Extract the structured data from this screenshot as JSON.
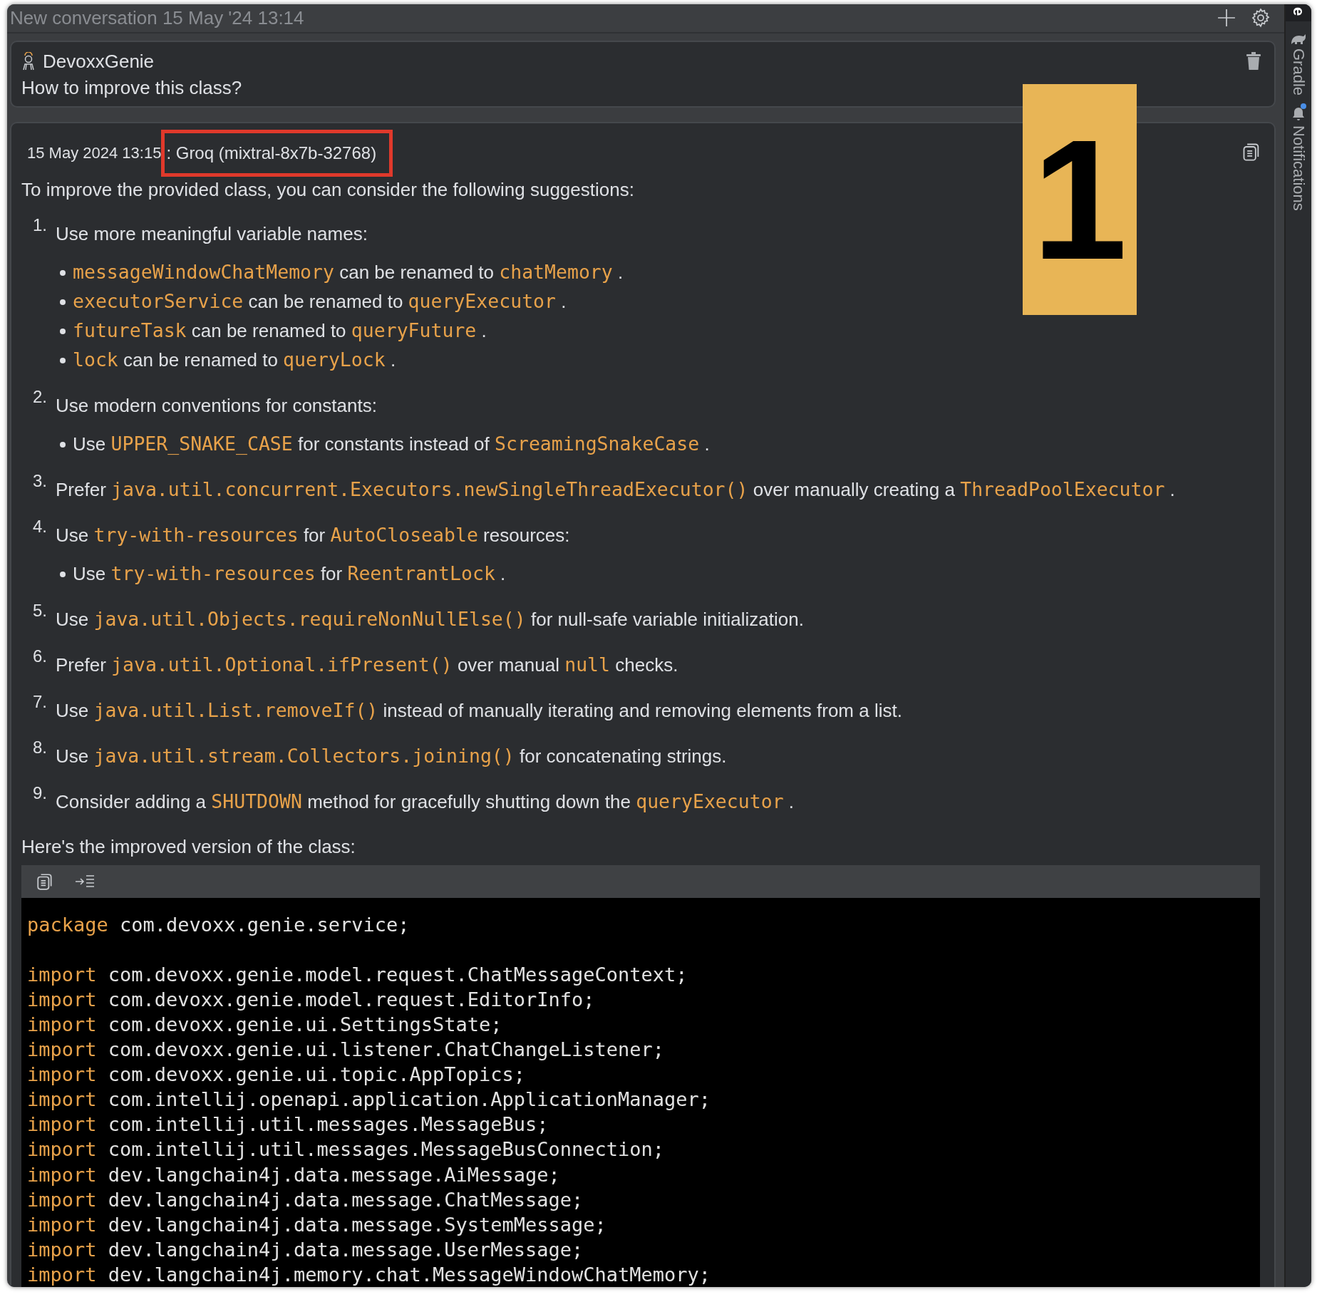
{
  "window": {
    "title": "New conversation 15 May '24 13:14"
  },
  "sidebar": {
    "items": [
      {
        "label": "e",
        "kind": "active"
      },
      {
        "label": "Gradle",
        "kind": "gradle",
        "badge": false
      },
      {
        "label": "Notifications",
        "kind": "notifications",
        "badge": true
      }
    ]
  },
  "question": {
    "author": "DevoxxGenie",
    "text": "How to improve this class?"
  },
  "answer": {
    "timestamp": "15 May 2024 13:15",
    "model": ": Groq (mixtral-8x7b-32768)",
    "model_highlighted": true,
    "intro": "To improve the provided class, you can consider the following suggestions:",
    "items": [
      {
        "number": "1.",
        "parts": [
          {
            "kind": "text",
            "text": "Use more meaningful variable names:"
          }
        ],
        "bullets": [
          [
            {
              "kind": "code",
              "text": "messageWindowChatMemory"
            },
            {
              "kind": "text",
              "text": " can be renamed to "
            },
            {
              "kind": "code",
              "text": "chatMemory"
            },
            {
              "kind": "text",
              "text": " ."
            }
          ],
          [
            {
              "kind": "code",
              "text": "executorService"
            },
            {
              "kind": "text",
              "text": " can be renamed to "
            },
            {
              "kind": "code",
              "text": "queryExecutor"
            },
            {
              "kind": "text",
              "text": " ."
            }
          ],
          [
            {
              "kind": "code",
              "text": "futureTask"
            },
            {
              "kind": "text",
              "text": " can be renamed to "
            },
            {
              "kind": "code",
              "text": "queryFuture"
            },
            {
              "kind": "text",
              "text": " ."
            }
          ],
          [
            {
              "kind": "code",
              "text": "lock"
            },
            {
              "kind": "text",
              "text": " can be renamed to "
            },
            {
              "kind": "code",
              "text": "queryLock"
            },
            {
              "kind": "text",
              "text": " ."
            }
          ]
        ]
      },
      {
        "number": "2.",
        "parts": [
          {
            "kind": "text",
            "text": "Use modern conventions for constants:"
          }
        ],
        "bullets": [
          [
            {
              "kind": "text",
              "text": "Use "
            },
            {
              "kind": "code",
              "text": "UPPER_SNAKE_CASE"
            },
            {
              "kind": "text",
              "text": " for constants instead of "
            },
            {
              "kind": "code",
              "text": "ScreamingSnakeCase"
            },
            {
              "kind": "text",
              "text": " ."
            }
          ]
        ]
      },
      {
        "number": "3.",
        "parts": [
          {
            "kind": "text",
            "text": "Prefer "
          },
          {
            "kind": "code",
            "text": "java.util.concurrent.Executors.newSingleThreadExecutor()"
          },
          {
            "kind": "text",
            "text": " over manually creating a "
          },
          {
            "kind": "code",
            "text": "ThreadPoolExecutor"
          },
          {
            "kind": "text",
            "text": " ."
          }
        ]
      },
      {
        "number": "4.",
        "parts": [
          {
            "kind": "text",
            "text": "Use "
          },
          {
            "kind": "code",
            "text": "try-with-resources"
          },
          {
            "kind": "text",
            "text": " for "
          },
          {
            "kind": "code",
            "text": "AutoCloseable"
          },
          {
            "kind": "text",
            "text": " resources:"
          }
        ],
        "bullets": [
          [
            {
              "kind": "text",
              "text": "Use "
            },
            {
              "kind": "code",
              "text": "try-with-resources"
            },
            {
              "kind": "text",
              "text": " for "
            },
            {
              "kind": "code",
              "text": "ReentrantLock"
            },
            {
              "kind": "text",
              "text": " ."
            }
          ]
        ]
      },
      {
        "number": "5.",
        "parts": [
          {
            "kind": "text",
            "text": "Use "
          },
          {
            "kind": "code",
            "text": "java.util.Objects.requireNonNullElse()"
          },
          {
            "kind": "text",
            "text": " for null-safe variable initialization."
          }
        ]
      },
      {
        "number": "6.",
        "parts": [
          {
            "kind": "text",
            "text": "Prefer "
          },
          {
            "kind": "code",
            "text": "java.util.Optional.ifPresent()"
          },
          {
            "kind": "text",
            "text": " over manual "
          },
          {
            "kind": "code",
            "text": "null"
          },
          {
            "kind": "text",
            "text": " checks."
          }
        ]
      },
      {
        "number": "7.",
        "parts": [
          {
            "kind": "text",
            "text": "Use "
          },
          {
            "kind": "code",
            "text": "java.util.List.removeIf()"
          },
          {
            "kind": "text",
            "text": " instead of manually iterating and removing elements from a list."
          }
        ]
      },
      {
        "number": "8.",
        "parts": [
          {
            "kind": "text",
            "text": "Use "
          },
          {
            "kind": "code",
            "text": "java.util.stream.Collectors.joining()"
          },
          {
            "kind": "text",
            "text": " for concatenating strings."
          }
        ]
      },
      {
        "number": "9.",
        "parts": [
          {
            "kind": "text",
            "text": "Consider adding a "
          },
          {
            "kind": "code",
            "text": "SHUTDOWN"
          },
          {
            "kind": "text",
            "text": " method for gracefully shutting down the "
          },
          {
            "kind": "code",
            "text": "queryExecutor"
          },
          {
            "kind": "text",
            "text": " ."
          }
        ]
      }
    ],
    "outro": "Here's the improved version of the class:",
    "code_lines": [
      {
        "kind": "line",
        "keyword": "package",
        "text": " com.devoxx.genie.service;"
      },
      {
        "kind": "blank"
      },
      {
        "kind": "line",
        "keyword": "import",
        "text": " com.devoxx.genie.model.request.ChatMessageContext;"
      },
      {
        "kind": "line",
        "keyword": "import",
        "text": " com.devoxx.genie.model.request.EditorInfo;"
      },
      {
        "kind": "line",
        "keyword": "import",
        "text": " com.devoxx.genie.ui.SettingsState;"
      },
      {
        "kind": "line",
        "keyword": "import",
        "text": " com.devoxx.genie.ui.listener.ChatChangeListener;"
      },
      {
        "kind": "line",
        "keyword": "import",
        "text": " com.devoxx.genie.ui.topic.AppTopics;"
      },
      {
        "kind": "line",
        "keyword": "import",
        "text": " com.intellij.openapi.application.ApplicationManager;"
      },
      {
        "kind": "line",
        "keyword": "import",
        "text": " com.intellij.util.messages.MessageBus;"
      },
      {
        "kind": "line",
        "keyword": "import",
        "text": " com.intellij.util.messages.MessageBusConnection;"
      },
      {
        "kind": "line",
        "keyword": "import",
        "text": " dev.langchain4j.data.message.AiMessage;"
      },
      {
        "kind": "line",
        "keyword": "import",
        "text": " dev.langchain4j.data.message.ChatMessage;"
      },
      {
        "kind": "line",
        "keyword": "import",
        "text": " dev.langchain4j.data.message.SystemMessage;"
      },
      {
        "kind": "line",
        "keyword": "import",
        "text": " dev.langchain4j.data.message.UserMessage;"
      },
      {
        "kind": "line",
        "keyword": "import",
        "text": " dev.langchain4j.memory.chat.MessageWindowChatMemory;"
      }
    ]
  },
  "callout": {
    "label": "1"
  }
}
